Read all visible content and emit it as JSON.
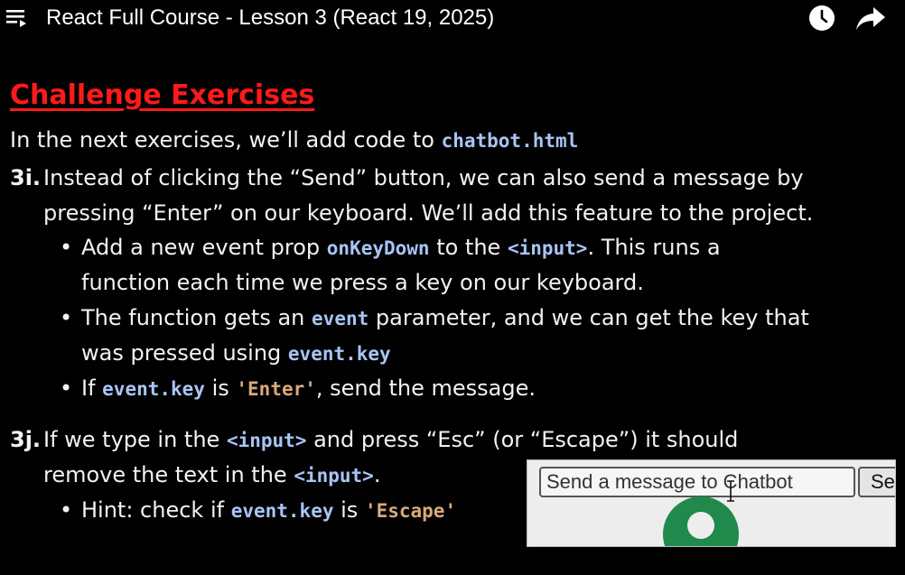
{
  "header": {
    "title": "React Full Course - Lesson 3 (React 19, 2025)",
    "icons": [
      "playlist-icon",
      "clock-icon",
      "share-icon"
    ]
  },
  "slide": {
    "heading": "Challenge Exercises",
    "intro": {
      "text": "In the next exercises, we’ll add code to ",
      "code": "chatbot.html"
    },
    "ex3i": {
      "number": "3i.",
      "line1": "Instead of clicking the “Send” button, we can also send a message by",
      "line2": "pressing “Enter” on our keyboard. We’ll add this feature to the project.",
      "bullet1": {
        "a": "Add a new event prop ",
        "code1": "onKeyDown",
        "b": " to the ",
        "code2": "<input>",
        "c": ". This runs a",
        "line2": "function each time we press a key on our keyboard."
      },
      "bullet2": {
        "a": "The function gets an ",
        "code1": "event",
        "b": " parameter, and we can get the key that",
        "line2a": "was pressed using ",
        "code2": "event.key"
      },
      "bullet3": {
        "a": "If ",
        "code1": "event.key",
        "b": " is ",
        "code2": "'Enter'",
        "c": ", send the message."
      }
    },
    "ex3j": {
      "number": "3j.",
      "line1a": "If we type in the ",
      "code1": "<input>",
      "line1b": " and press “Esc” (or “Escape”) it should",
      "line2a": "remove the text in the ",
      "code2": "<input>",
      "line2b": ".",
      "hint": {
        "a": "Hint: check if ",
        "code1": "event.key",
        "b": " is ",
        "code2": "'Escape'"
      }
    },
    "bullet_char": "•"
  },
  "preview": {
    "input_placeholder": "Send a message to Chatbot",
    "send_label": "Se"
  },
  "colors": {
    "heading": "#ff1a1a",
    "code": "#a9c4f5",
    "string": "#d8a97a",
    "avatar": "#1f8a4c"
  }
}
